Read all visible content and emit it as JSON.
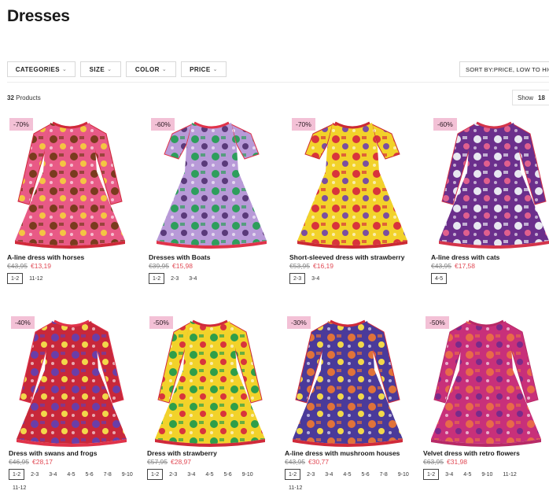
{
  "page": {
    "title": "Dresses"
  },
  "filters": [
    {
      "label": "CATEGORIES"
    },
    {
      "label": "SIZE"
    },
    {
      "label": "COLOR"
    },
    {
      "label": "PRICE"
    }
  ],
  "sort": {
    "label": "SORT BY:PRICE, LOW TO HIGH"
  },
  "results": {
    "count": "32",
    "label": "Products"
  },
  "show": {
    "label": "Show",
    "value": "18"
  },
  "products": [
    {
      "discount": "-70%",
      "name": "A-line dress with horses",
      "old_price": "€43,95",
      "price": "€13,19",
      "sizes": [
        "1-2",
        "11-12"
      ],
      "colors": {
        "body": "#e85a86",
        "pattern": "#7a3b1e",
        "trim": "#d02a3a",
        "accent": "#f4c542"
      }
    },
    {
      "discount": "-60%",
      "name": "Dresses with Boats",
      "old_price": "€39,95",
      "price": "€15,98",
      "sizes": [
        "1-2",
        "2-3",
        "3-4"
      ],
      "colors": {
        "body": "#b89ad8",
        "pattern": "#2e9e5c",
        "trim": "#e0334a",
        "accent": "#5a3a7a"
      }
    },
    {
      "discount": "-70%",
      "name": "Short-sleeved dress with strawberry",
      "old_price": "€53,95",
      "price": "€16,19",
      "sizes": [
        "2-3",
        "3-4"
      ],
      "colors": {
        "body": "#f2d22a",
        "pattern": "#d8343c",
        "trim": "#cc2a33",
        "accent": "#7a4ea0"
      }
    },
    {
      "discount": "-60%",
      "name": "A-line dress with cats",
      "old_price": "€43,95",
      "price": "€17,58",
      "sizes": [
        "4-5"
      ],
      "colors": {
        "body": "#6b2f8c",
        "pattern": "#e8e8f0",
        "trim": "#d3344a",
        "accent": "#e0608e"
      }
    },
    {
      "discount": "-40%",
      "name": "Dress with swans and frogs",
      "old_price": "€46,95",
      "price": "€28,17",
      "sizes": [
        "1-2",
        "2-3",
        "3-4",
        "4-5",
        "5-6",
        "7-8",
        "9-10",
        "11-12"
      ],
      "colors": {
        "body": "#c8283a",
        "pattern": "#6a3ea8",
        "trim": "#e0334a",
        "accent": "#f2d84a"
      }
    },
    {
      "discount": "-50%",
      "name": "Dress with strawberry",
      "old_price": "€57,95",
      "price": "€28,97",
      "sizes": [
        "1-2",
        "2-3",
        "3-4",
        "4-5",
        "5-6",
        "9-10"
      ],
      "colors": {
        "body": "#f2d22a",
        "pattern": "#2e9e4a",
        "trim": "#d02a3a",
        "accent": "#d8343c"
      }
    },
    {
      "discount": "-30%",
      "name": "A-line dress with mushroom houses",
      "old_price": "€43,95",
      "price": "€30,77",
      "sizes": [
        "1-2",
        "2-3",
        "3-4",
        "4-5",
        "5-6",
        "7-8",
        "9-10",
        "11-12"
      ],
      "colors": {
        "body": "#4a3a9a",
        "pattern": "#e0733a",
        "trim": "#d02a3a",
        "accent": "#f2d84a"
      }
    },
    {
      "discount": "-50%",
      "name": "Velvet dress with retro flowers",
      "old_price": "€63,95",
      "price": "€31,98",
      "sizes": [
        "1-2",
        "3-4",
        "4-5",
        "9-10",
        "11-12"
      ],
      "colors": {
        "body": "#c8307a",
        "pattern": "#e86a4a",
        "trim": "#b82a66",
        "accent": "#7a2a8a"
      }
    }
  ]
}
